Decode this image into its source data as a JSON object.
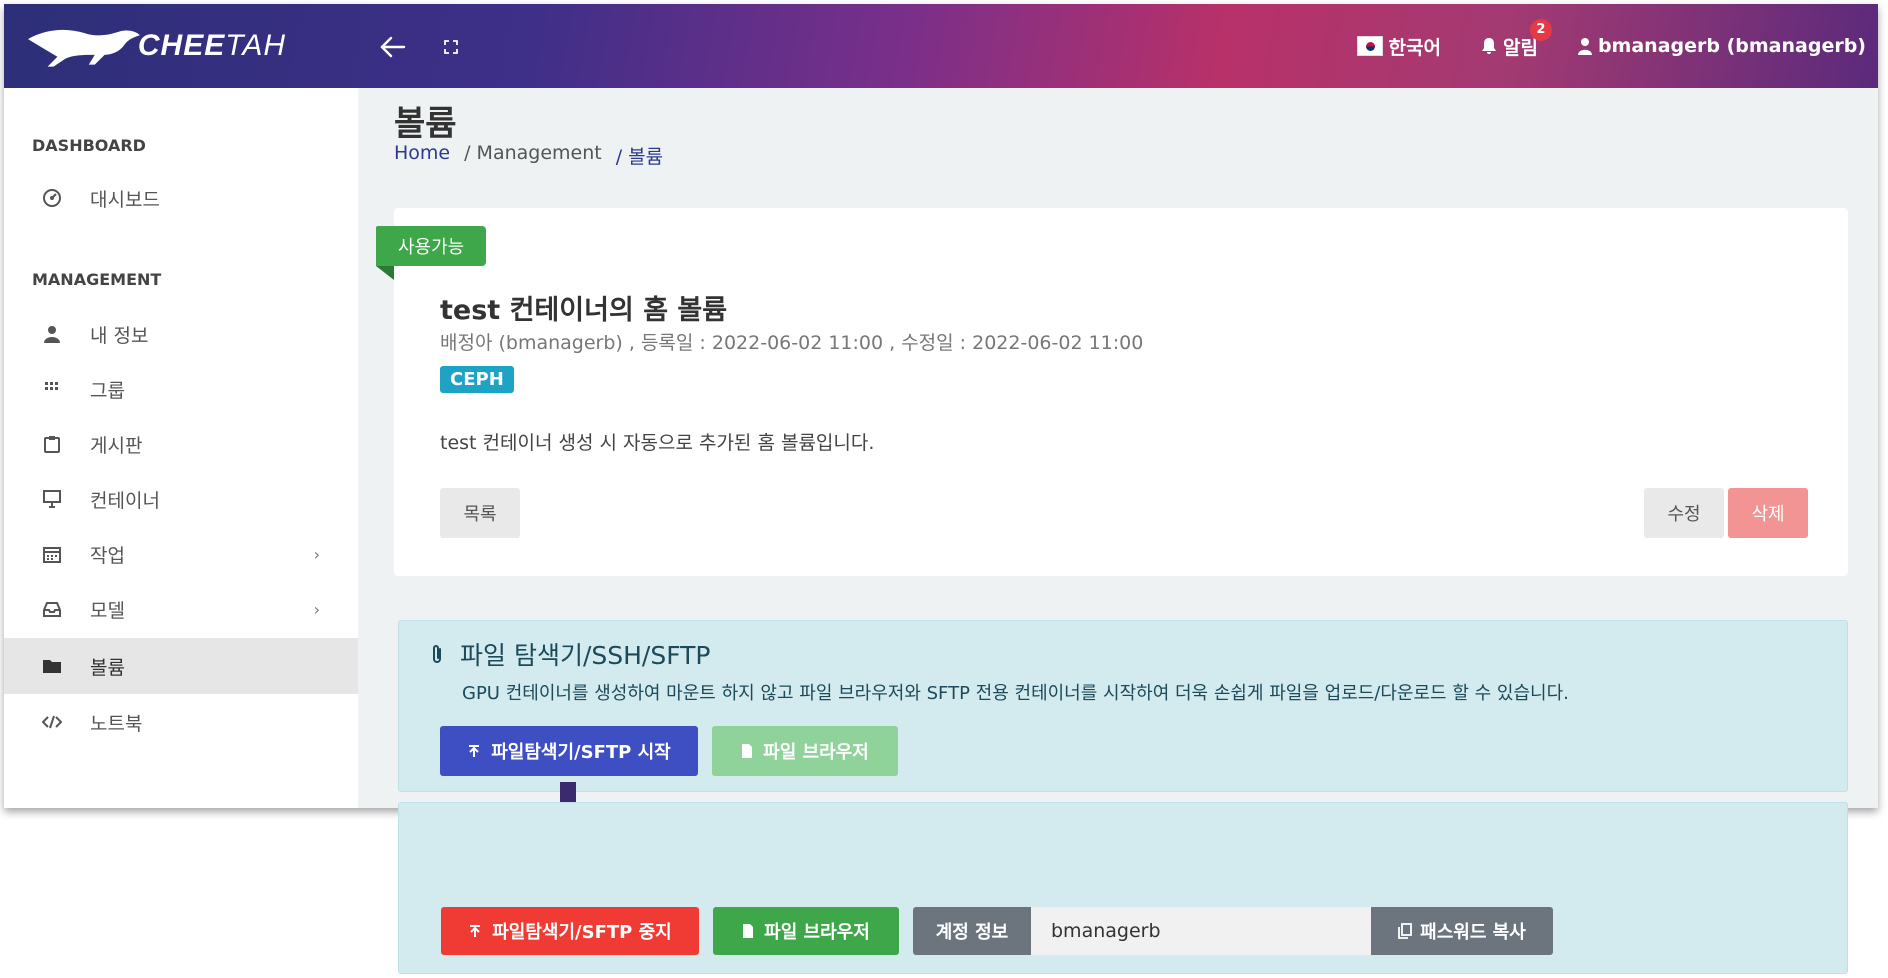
{
  "header": {
    "logo_text_bold": "CHEE",
    "logo_text_thin": "TAH",
    "language": "한국어",
    "alerts_label": "알림",
    "alerts_count": "2",
    "user": "bmanagerb (bmanagerb)",
    "back_icon": "arrow-left-icon",
    "fullscreen_icon": "fullscreen-icon"
  },
  "sidebar": {
    "section_dashboard": "DASHBOARD",
    "section_management": "MANAGEMENT",
    "items": [
      {
        "label": "대시보드",
        "icon": "dashboard-icon"
      },
      {
        "label": "내 정보",
        "icon": "user-icon"
      },
      {
        "label": "그룹",
        "icon": "grid-icon"
      },
      {
        "label": "게시판",
        "icon": "clipboard-icon"
      },
      {
        "label": "컨테이너",
        "icon": "monitor-icon"
      },
      {
        "label": "작업",
        "icon": "calendar-icon"
      },
      {
        "label": "모델",
        "icon": "inbox-icon"
      },
      {
        "label": "볼륨",
        "icon": "folder-icon"
      },
      {
        "label": "노트북",
        "icon": "code-icon"
      }
    ]
  },
  "page": {
    "title": "볼륨",
    "breadcrumb": [
      "Home",
      "/ Management",
      "/ 볼륨"
    ]
  },
  "card": {
    "status": "사용가능",
    "title": "test 컨테이너의 홈 볼륨",
    "meta": "배정아 (bmanagerb) , 등록일 : 2022-06-02 11:00 , 수정일 : 2022-06-02 11:00",
    "tag": "CEPH",
    "description": "test 컨테이너 생성 시 자동으로 추가된 홈 볼륨입니다.",
    "list_button": "목록",
    "edit_button": "수정",
    "delete_button": "삭제"
  },
  "info": {
    "title": "파일 탐색기/SSH/SFTP",
    "description": "GPU 컨테이너를 생성하여 마운트 하지 않고 파일 브라우저와 SFTP 전용 컨테이너를 시작하여 더욱 손쉽게 파일을 업로드/다운로드 할 수 있습니다.",
    "start_button": "파일탐색기/SFTP 시작",
    "browser_button": "파일 브라우저"
  },
  "panel2": {
    "stop_button": "파일탐색기/SFTP 중지",
    "browser_button": "파일 브라우저",
    "account_label": "계정 정보",
    "account_value": "bmanagerb",
    "copy_password_button": "패스워드 복사"
  },
  "colors": {
    "header_start": "#2d2f78",
    "header_mid": "#b83169",
    "ribbon": "#3ea74a",
    "ceph": "#1ea3c4",
    "primary": "#3d4fc2",
    "danger": "#ef3b34",
    "arrow": "#3b2a6e"
  }
}
